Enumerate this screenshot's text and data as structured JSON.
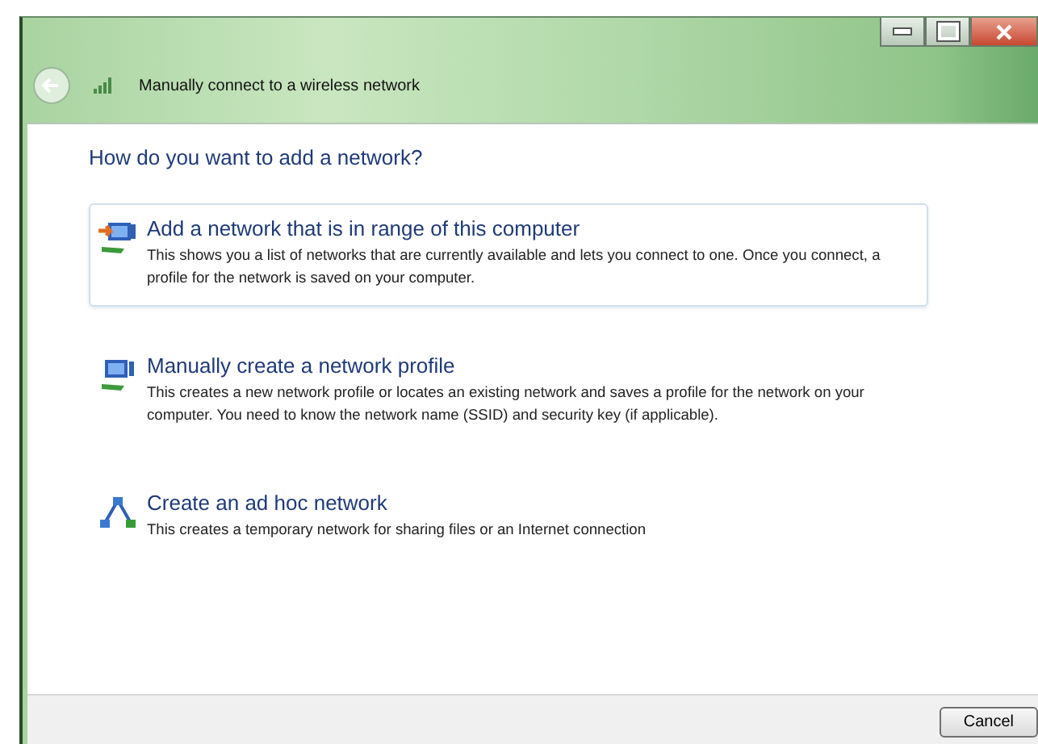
{
  "window": {
    "title": "Manually connect to a wireless network"
  },
  "heading": "How do you want to add a network?",
  "options": [
    {
      "title": "Add a network that is in range of this computer",
      "description": "This shows you a list of networks that are currently available and lets you connect to one. Once you connect, a profile for the network is saved on your computer.",
      "selected": true,
      "kind": "search"
    },
    {
      "title": "Manually create a network profile",
      "description": "This creates a new network profile or locates an existing network and saves a profile for the network on your computer. You need to know the network name (SSID) and security key (if applicable).",
      "selected": false,
      "kind": "profile"
    },
    {
      "title": "Create an ad hoc network",
      "description": "This creates a temporary network for sharing files or an Internet connection",
      "selected": false,
      "kind": "adhoc"
    }
  ],
  "buttons": [
    "Cancel"
  ]
}
